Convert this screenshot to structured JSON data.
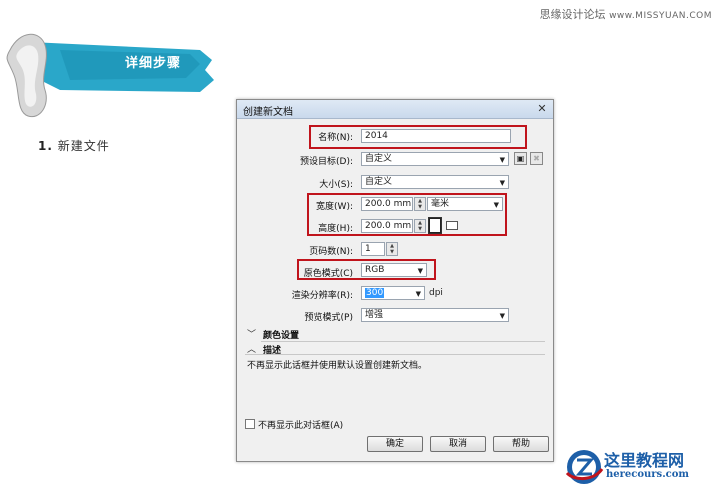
{
  "watermark": {
    "cn": "思缘设计论坛",
    "en": "www.MISSYUAN.COM"
  },
  "banner": {
    "text": "详细步骤"
  },
  "step": {
    "number": "1.",
    "text": "新建文件"
  },
  "dialog": {
    "title": "创建新文档",
    "name": {
      "label": "名称(N):",
      "value": "2014"
    },
    "preset": {
      "label": "预设目标(D):",
      "value": "自定义"
    },
    "size": {
      "label": "大小(S):",
      "value": "自定义"
    },
    "width": {
      "label": "宽度(W):",
      "value": "200.0 mm",
      "unit": "毫米"
    },
    "height": {
      "label": "高度(H):",
      "value": "200.0 mm"
    },
    "pages": {
      "label": "页码数(N):",
      "value": "1"
    },
    "color_mode": {
      "label": "原色模式(C)",
      "value": "RGB"
    },
    "resolution": {
      "label": "渲染分辨率(R):",
      "value": "300",
      "unit": "dpi"
    },
    "preview": {
      "label": "预览模式(P)",
      "value": "增强"
    },
    "color_settings": "颜色设置",
    "description_header": "描述",
    "description_text": "不再显示此话框并使用默认设置创建新文档。",
    "dont_show": "不再显示此对话框(A)",
    "ok": "确定",
    "cancel": "取消",
    "help": "帮助"
  },
  "brand": {
    "cn": "这里教程网",
    "en": "herecours.com"
  },
  "colors": {
    "highlight": "#c0141c",
    "banner": "#2aa7c9",
    "brand": "#1d5fa8"
  }
}
